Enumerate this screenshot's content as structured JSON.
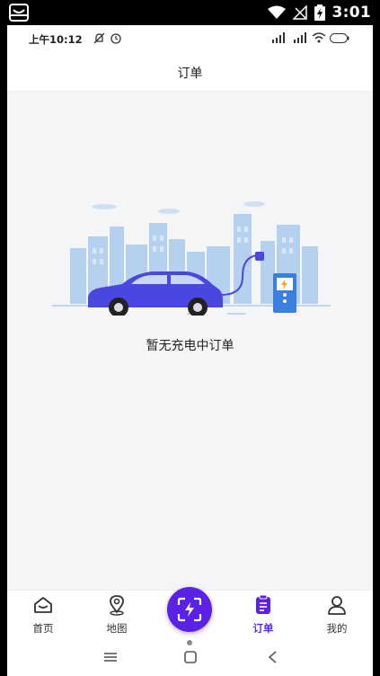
{
  "system": {
    "time": "3:01"
  },
  "status": {
    "time": "上午10:12"
  },
  "header": {
    "title": "订单"
  },
  "empty_state": {
    "message": "暂无充电中订单"
  },
  "tabs": [
    {
      "label": "首页",
      "icon": "home-icon"
    },
    {
      "label": "地图",
      "icon": "map-pin-icon"
    },
    {
      "label": "",
      "icon": "scan-charge-icon"
    },
    {
      "label": "订单",
      "icon": "order-clipboard-icon",
      "active": true
    },
    {
      "label": "我的",
      "icon": "user-icon"
    }
  ],
  "colors": {
    "accent": "#5b21e6",
    "car": "#4a47e0",
    "skyline": "#a9c8ee",
    "charger": "#3b7fe0"
  }
}
